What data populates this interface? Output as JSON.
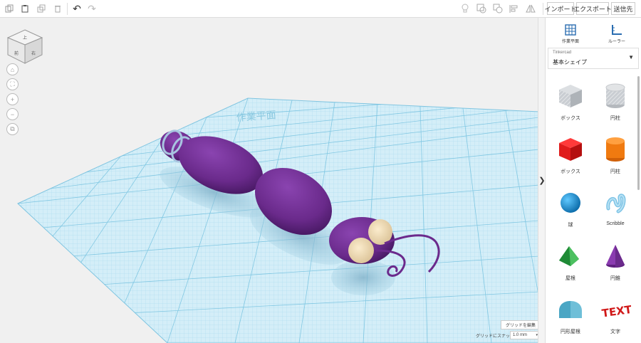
{
  "toolbar": {
    "import_label": "インポート",
    "export_label": "エクスポート",
    "send_label": "送信先"
  },
  "sidebar": {
    "workplane_label": "作業平面",
    "ruler_label": "ルーラー",
    "library_small": "Tinkercad",
    "library_name": "基本シェイプ",
    "shapes": [
      {
        "label": "ボックス",
        "icon": "box-striped-icon"
      },
      {
        "label": "円柱",
        "icon": "cylinder-striped-icon"
      },
      {
        "label": "ボックス",
        "icon": "box-red-icon"
      },
      {
        "label": "円柱",
        "icon": "cylinder-orange-icon"
      },
      {
        "label": "球",
        "icon": "sphere-blue-icon"
      },
      {
        "label": "Scribble",
        "icon": "scribble-icon"
      },
      {
        "label": "屋根",
        "icon": "roof-green-icon"
      },
      {
        "label": "円錐",
        "icon": "cone-purple-icon"
      },
      {
        "label": "円形屋根",
        "icon": "round-roof-icon"
      },
      {
        "label": "文字",
        "icon": "text-red-icon"
      }
    ]
  },
  "viewcube": {
    "top_face": "上",
    "left_face": "前",
    "right_face": "右"
  },
  "workplane": {
    "grid_text": "作業平面"
  },
  "footer": {
    "edit_grid_label": "グリッドを編集",
    "snap_label": "グリッドにスナップ",
    "snap_value": "1.0 mm"
  },
  "colors": {
    "body": "#6b2a8c",
    "rings": "#a8c4e0",
    "eyes": "#f2dcb5",
    "grid": "#8ed0e6",
    "brand_toolbar": "#ffffff"
  }
}
